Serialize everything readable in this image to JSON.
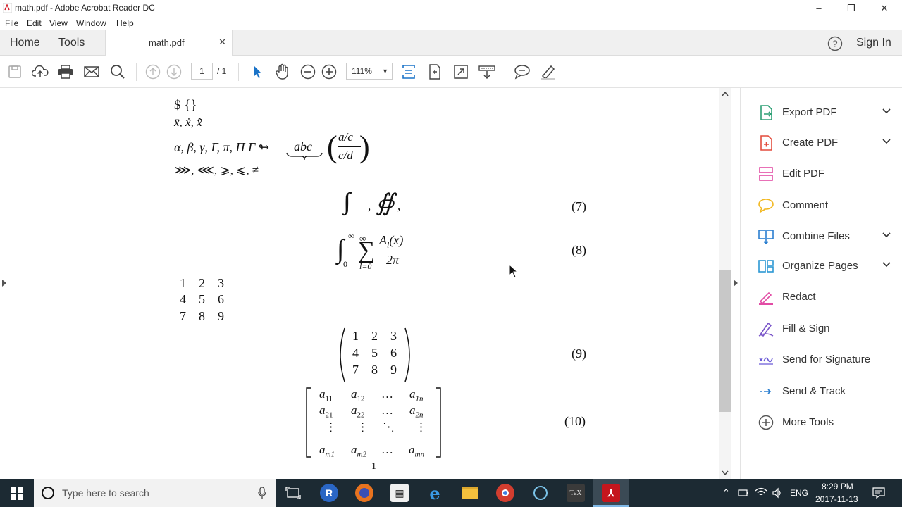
{
  "window": {
    "title": "math.pdf - Adobe Acrobat Reader DC"
  },
  "menu": [
    "File",
    "Edit",
    "View",
    "Window",
    "Help"
  ],
  "tabs": {
    "home": "Home",
    "tools": "Tools",
    "doc_tab": "math.pdf"
  },
  "signin": "Sign In",
  "toolbar": {
    "page_current": "1",
    "page_total": "/ 1",
    "zoom": "111%"
  },
  "doc": {
    "dollar": "$ {}",
    "accents": "x̄, ẋ, x̃",
    "greek": "α, β, γ, Γ, π, Π Γ ↬",
    "abc": "abc",
    "frac_top": "a/c",
    "frac_bot": "c/d",
    "relations": "⋙, ⋘, ⩾, ⩽, ≠",
    "eq7": "(7)",
    "eq8": "(8)",
    "eq9": "(9)",
    "eq10": "(10)",
    "A_l": "A",
    "two_pi": "2π",
    "plain_matrix": [
      [
        "1",
        "2",
        "3"
      ],
      [
        "4",
        "5",
        "6"
      ],
      [
        "7",
        "8",
        "9"
      ]
    ],
    "paren_matrix": [
      [
        "1",
        "2",
        "3"
      ],
      [
        "4",
        "5",
        "6"
      ],
      [
        "7",
        "8",
        "9"
      ]
    ],
    "page_number": "1"
  },
  "right_panel": [
    {
      "label": "Export PDF",
      "icon": "export-pdf-icon",
      "color": "#2d9f75",
      "chevron": true
    },
    {
      "label": "Create PDF",
      "icon": "create-pdf-icon",
      "color": "#e34c3d",
      "chevron": true
    },
    {
      "label": "Edit PDF",
      "icon": "edit-pdf-icon",
      "color": "#e24ca5",
      "chevron": false
    },
    {
      "label": "Comment",
      "icon": "comment-icon",
      "color": "#f2b821",
      "chevron": false
    },
    {
      "label": "Combine Files",
      "icon": "combine-files-icon",
      "color": "#2b7fd0",
      "chevron": true
    },
    {
      "label": "Organize Pages",
      "icon": "organize-pages-icon",
      "color": "#2b97d3",
      "chevron": true
    },
    {
      "label": "Redact",
      "icon": "redact-icon",
      "color": "#e24ca5",
      "chevron": false
    },
    {
      "label": "Fill & Sign",
      "icon": "fill-sign-icon",
      "color": "#7a55c9",
      "chevron": false
    },
    {
      "label": "Send for Signature",
      "icon": "send-for-signature-icon",
      "color": "#6b5bd6",
      "chevron": false
    },
    {
      "label": "Send & Track",
      "icon": "send-track-icon",
      "color": "#2b7fd0",
      "chevron": false
    },
    {
      "label": "More Tools",
      "icon": "more-tools-icon",
      "color": "#555555",
      "chevron": false
    }
  ],
  "taskbar": {
    "search_placeholder": "Type here to search",
    "lang": "ENG",
    "time": "8:29 PM",
    "date": "2017-11-13"
  }
}
